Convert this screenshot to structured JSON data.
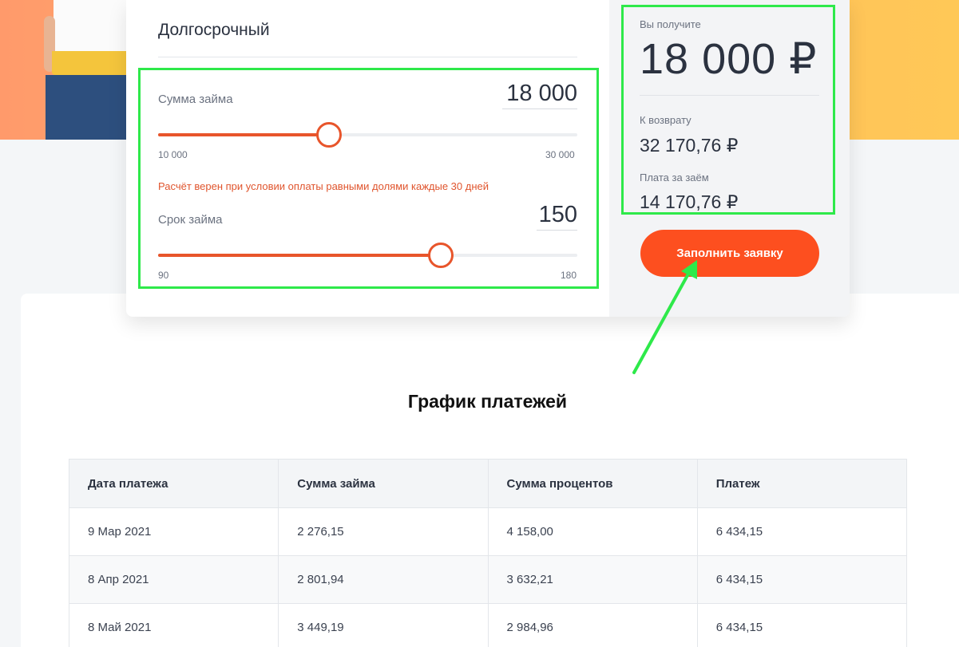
{
  "loan_type": "Долгосрочный",
  "amount": {
    "label": "Сумма займа",
    "value": "18 000",
    "min": "10 000",
    "max": "30 000",
    "position": 0.4
  },
  "note": "Расчёт верен при условии оплаты равными долями каждые 30 дней",
  "term": {
    "label": "Срок займа",
    "value": "150",
    "min": "90",
    "max": "180",
    "position": 0.667
  },
  "summary": {
    "receive_label": "Вы получите",
    "receive_value": "18 000 ₽",
    "return_label": "К возврату",
    "return_value": "32 170,76 ₽",
    "fee_label": "Плата за заём",
    "fee_value": "14 170,76 ₽"
  },
  "cta_label": "Заполнить заявку",
  "schedule": {
    "title": "График платежей",
    "headers": [
      "Дата платежа",
      "Сумма займа",
      "Сумма процентов",
      "Платеж"
    ],
    "rows": [
      [
        "9 Мар 2021",
        "2 276,15",
        "4 158,00",
        "6 434,15"
      ],
      [
        "8 Апр 2021",
        "2 801,94",
        "3 632,21",
        "6 434,15"
      ],
      [
        "8 Май 2021",
        "3 449,19",
        "2 984,96",
        "6 434,15"
      ]
    ]
  },
  "colors": {
    "accent": "#fd4f1f",
    "slider": "#e8552b",
    "highlight": "#2ee94a"
  }
}
